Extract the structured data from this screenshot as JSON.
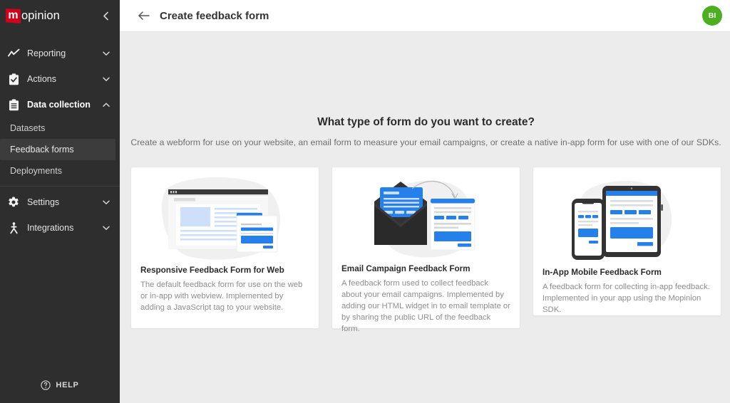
{
  "sidebar": {
    "logo": {
      "badge": "m",
      "text": "opinion"
    },
    "collapse_icon": "chevron-left-icon",
    "nav": [
      {
        "label": "Reporting",
        "icon": "line-chart-icon",
        "chevron": "chevron-down-icon",
        "expanded": false
      },
      {
        "label": "Actions",
        "icon": "clipboard-check-icon",
        "chevron": "chevron-down-icon",
        "expanded": false
      },
      {
        "label": "Data collection",
        "icon": "clipboard-lines-icon",
        "chevron": "chevron-up-icon",
        "expanded": true
      }
    ],
    "subnav": [
      {
        "label": "Datasets",
        "selected": false
      },
      {
        "label": "Feedback forms",
        "selected": true
      },
      {
        "label": "Deployments",
        "selected": false
      }
    ],
    "nav_bottom": [
      {
        "label": "Settings",
        "icon": "gear-icon",
        "chevron": "chevron-down-icon"
      },
      {
        "label": "Integrations",
        "icon": "integrations-node-icon",
        "chevron": "chevron-down-icon"
      }
    ],
    "help": {
      "label": "HELP",
      "icon": "question-circle-icon"
    }
  },
  "topbar": {
    "back_icon": "arrow-left-icon",
    "title": "Create feedback form",
    "avatar_initials": "BI"
  },
  "main": {
    "heading": "What type of form do you want to create?",
    "subheading": "Create a webform for use on your website, an email form to measure your email campaigns, or create a native in-app form for use with one of our SDKs.",
    "cards": [
      {
        "id": "responsive-web",
        "art": "browser-window-with-form-illustration",
        "title": "Responsive Feedback Form for Web",
        "description": "The default feedback form for use on the web or in-app with webview. Implemented by adding a JavaScript tag to your website."
      },
      {
        "id": "email-campaign",
        "art": "open-envelope-with-form-illustration",
        "title": "Email Campaign Feedback Form",
        "description": "A feedback form used to collect feedback about your email campaigns. Implemented by adding our HTML widget in to email template or by sharing the public URL of the feedback form."
      },
      {
        "id": "in-app-mobile",
        "art": "phone-and-tablet-illustration",
        "title": "In-App Mobile Feedback Form",
        "description": "A feedback form for collecting in-app feedback. Implemented in your app using the Mopinion SDK."
      }
    ]
  },
  "colors": {
    "sidebar_bg": "#2e2e2e",
    "sidebar_active": "#3c3c3c",
    "logo_red": "#d0011b",
    "avatar_green": "#4caf20",
    "accent_blue": "#2680eb",
    "page_bg": "#ececec",
    "card_bg": "#ffffff"
  }
}
